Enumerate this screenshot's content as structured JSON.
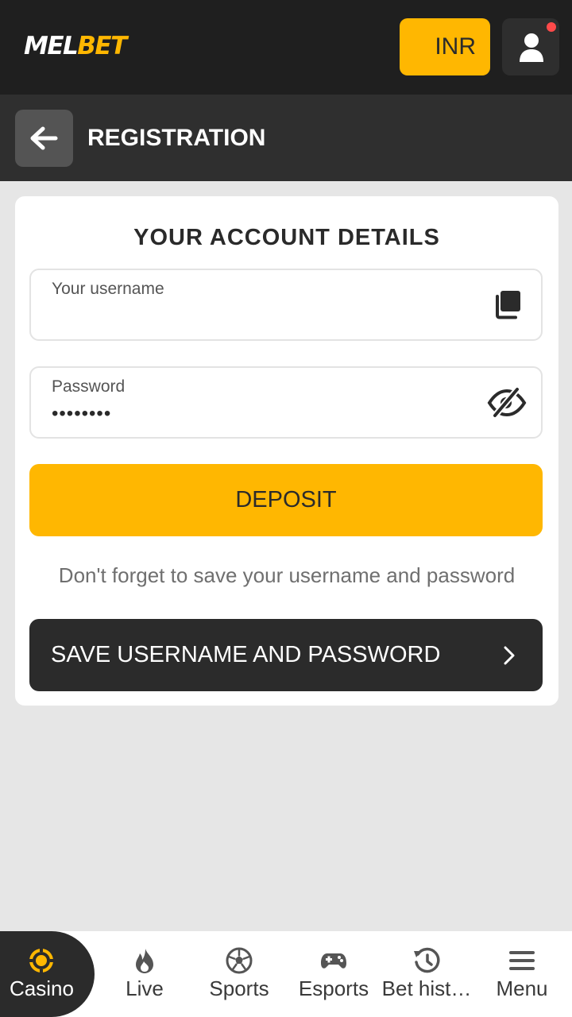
{
  "header": {
    "logo_part1": "MEL",
    "logo_part2": "BET",
    "currency": "INR"
  },
  "subheader": {
    "title": "REGISTRATION"
  },
  "form": {
    "title": "YOUR ACCOUNT DETAILS",
    "username_label": "Your username",
    "username_value": "",
    "password_label": "Password",
    "password_value": "••••••••",
    "deposit_label": "DEPOSIT",
    "hint": "Don't forget to save your username and password",
    "save_label": "SAVE USERNAME AND PASSWORD"
  },
  "bottom_nav": {
    "items": [
      {
        "label": "Casino",
        "icon": "casino-chip-icon",
        "active": true
      },
      {
        "label": "Live",
        "icon": "flame-icon",
        "active": false
      },
      {
        "label": "Sports",
        "icon": "soccer-ball-icon",
        "active": false
      },
      {
        "label": "Esports",
        "icon": "gamepad-icon",
        "active": false
      },
      {
        "label": "Bet hist…",
        "icon": "history-icon",
        "active": false
      },
      {
        "label": "Menu",
        "icon": "hamburger-menu-icon",
        "active": false
      }
    ]
  },
  "colors": {
    "accent": "#ffb701",
    "header_bg": "#1f1f1f",
    "subheader_bg": "#2f2f2f",
    "page_bg": "#e6e6e6",
    "notification": "#ff4a4a"
  }
}
